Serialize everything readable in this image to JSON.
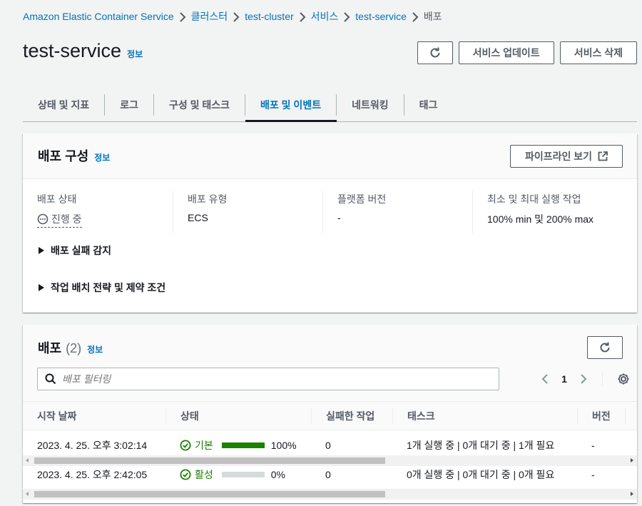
{
  "breadcrumb": {
    "items": [
      "Amazon Elastic Container Service",
      "클러스터",
      "test-cluster",
      "서비스",
      "test-service",
      "배포"
    ]
  },
  "header": {
    "title": "test-service",
    "info": "정보",
    "update_button": "서비스 업데이트",
    "delete_button": "서비스 삭제"
  },
  "tabs": [
    {
      "label": "상태 및 지표",
      "active": false
    },
    {
      "label": "로그",
      "active": false
    },
    {
      "label": "구성 및 태스크",
      "active": false
    },
    {
      "label": "배포 및 이벤트",
      "active": true
    },
    {
      "label": "네트워킹",
      "active": false
    },
    {
      "label": "태그",
      "active": false
    }
  ],
  "deploy_config": {
    "title": "배포 구성",
    "info": "정보",
    "pipeline_button": "파이프라인 보기",
    "fields": [
      {
        "label": "배포 상태",
        "value": "진행 중"
      },
      {
        "label": "배포 유형",
        "value": "ECS"
      },
      {
        "label": "플랫폼 버전",
        "value": "-"
      },
      {
        "label": "최소 및 최대 실행 작업",
        "value": "100% min 및 200% max"
      }
    ],
    "expanders": [
      "배포 실패 감지",
      "작업 배치 전략 및 제약 조건"
    ]
  },
  "deployments": {
    "title": "배포",
    "count": "(2)",
    "info": "정보",
    "filter_placeholder": "배포 필터링",
    "page": "1",
    "columns": [
      "시작 날짜",
      "상태",
      "실패한 작업",
      "태스크",
      "버전"
    ],
    "rows": [
      {
        "start": "2023. 4. 25. 오후 3:02:14",
        "status": "기본",
        "progress": 1.0,
        "progress_label": "100%",
        "failed": "0",
        "tasks": "1개 실행 중 | 0개 대기 중 | 1개 필요",
        "version": "-"
      },
      {
        "start": "2023. 4. 25. 오후 2:42:05",
        "status": "활성",
        "progress": 0.0,
        "progress_label": "0%",
        "failed": "0",
        "tasks": "0개 실행 중 | 0개 대기 중 | 0개 필요",
        "version": "-"
      }
    ]
  },
  "colors": {
    "link": "#0073bb",
    "success": "#1d8102",
    "text": "#16191f",
    "muted": "#545b64"
  }
}
